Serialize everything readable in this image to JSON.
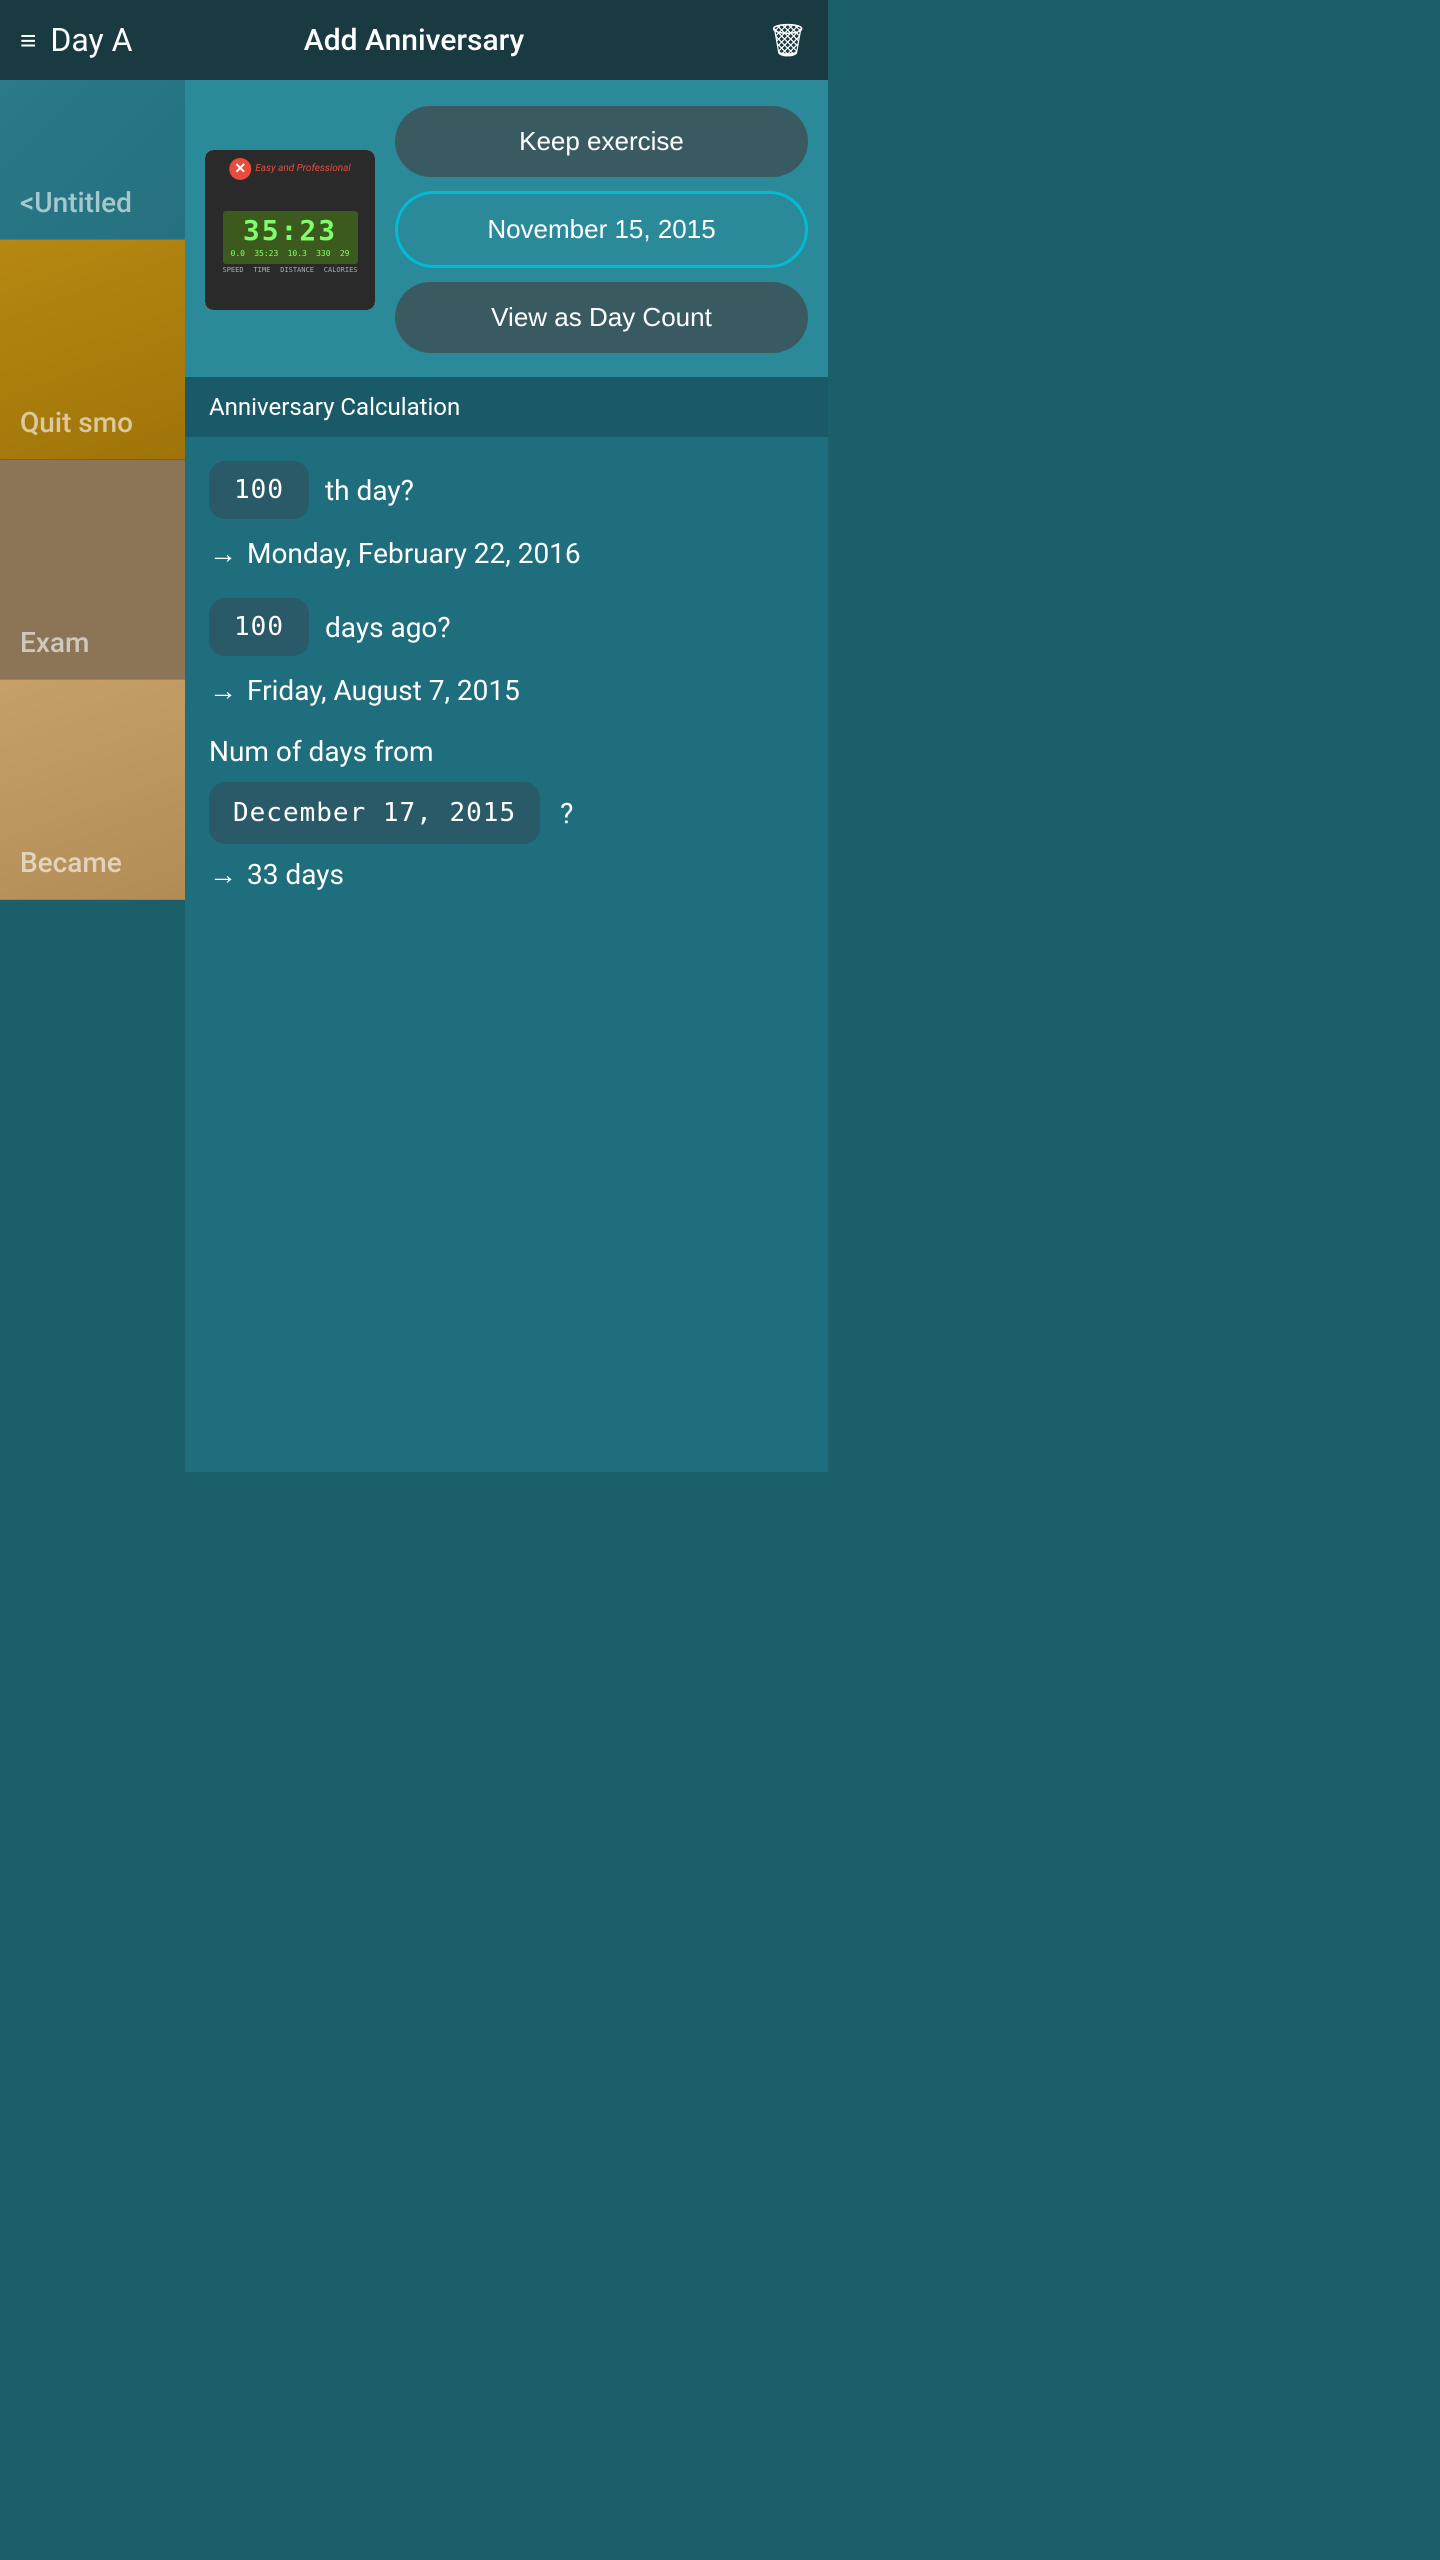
{
  "header": {
    "menu_icon": "≡",
    "bg_title": "Day A",
    "overlay_title": "Add Anniversary",
    "trash_icon": "🗑"
  },
  "background_list": [
    {
      "id": "untitled",
      "title": "<Untitled",
      "type": "plain"
    },
    {
      "id": "quit-smoking",
      "title": "Quit smo",
      "type": "food"
    },
    {
      "id": "exam",
      "title": "Exam",
      "type": "calendar"
    },
    {
      "id": "became",
      "title": "Became",
      "type": "food2"
    }
  ],
  "overlay": {
    "exercise_display": "35:23",
    "exercise_stats": [
      "0.0  35:23  10.3  330  29"
    ],
    "exercise_labels": [
      "SPEED",
      "TIME",
      "DISTANCE",
      "CALORIES"
    ],
    "logo_text": "Easy and Professional",
    "buttons": {
      "keep_exercise": "Keep exercise",
      "date": "November 15, 2015",
      "view_day_count": "View as Day Count"
    }
  },
  "anniversary_section": {
    "header": "Anniversary Calculation",
    "calc1": {
      "badge": "100",
      "label": "th day?",
      "result": "Monday, February 22, 2016"
    },
    "calc2": {
      "badge": "100",
      "label": "days ago?",
      "result": "Friday, August 7, 2015"
    },
    "num_days": {
      "label": "Num of days from",
      "date_badge": "December 17, 2015",
      "question": "?",
      "result": "33 days"
    }
  }
}
